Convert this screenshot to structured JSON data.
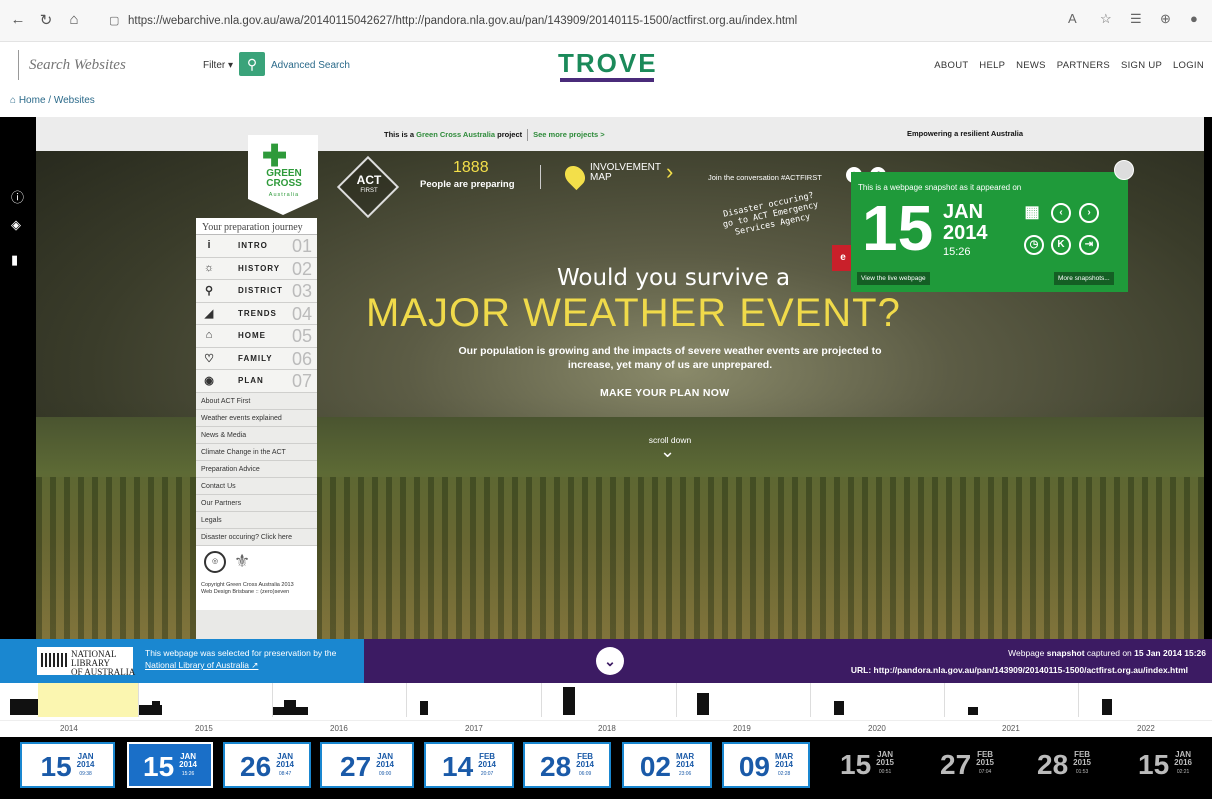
{
  "browser": {
    "url": "https://webarchive.nla.gov.au/awa/20140115042627/http://pandora.nla.gov.au/pan/143909/20140115-1500/actfirst.org.au/index.html"
  },
  "header": {
    "search_placeholder": "Search Websites",
    "filter_label": "Filter ▾",
    "advanced_search": "Advanced Search",
    "logo": "TROVE",
    "nav": [
      "ABOUT",
      "HELP",
      "NEWS",
      "PARTNERS",
      "SIGN UP",
      "LOGIN"
    ]
  },
  "breadcrumb": "Home / Websites",
  "archived_page": {
    "strip_project": "This is a ",
    "strip_gca": "Green Cross Australia",
    "strip_project_end": " project",
    "strip_more": "See more projects >",
    "strip_tagline": "Empowering a resilient Australia",
    "gc_logo": "GREEN\nCROSS",
    "gc_sub": "Australia",
    "act": "ACT",
    "act_sub": "FIRST",
    "people_num": "1888",
    "people_txt": "People are preparing",
    "involvement": "INVOLVEMENT\nMAP",
    "join": "Join the conversation #ACTFIRST",
    "disaster_note": "Disaster occuring?\ngo to ACT Emergency\nServices Agency",
    "red_btn": "e",
    "hero_q": "Would you survive a",
    "hero_big": "MAJOR WEATHER EVENT?",
    "hero_body": "Our population is growing and the impacts of severe weather events are projected to increase, yet many of us are unprepared.",
    "cta": "MAKE YOUR PLAN NOW",
    "scroll": "scroll down",
    "journey_title": "Your preparation journey",
    "menu": [
      {
        "icon": "i",
        "label": "INTRO",
        "num": "01"
      },
      {
        "icon": "☼",
        "label": "HISTORY",
        "num": "02"
      },
      {
        "icon": "⚲",
        "label": "DISTRICT",
        "num": "03"
      },
      {
        "icon": "◢",
        "label": "TRENDS",
        "num": "04"
      },
      {
        "icon": "⌂",
        "label": "HOME",
        "num": "05"
      },
      {
        "icon": "♡",
        "label": "FAMILY",
        "num": "06"
      },
      {
        "icon": "◉",
        "label": "PLAN",
        "num": "07"
      }
    ],
    "links": [
      "About ACT First",
      "Weather events explained",
      "News & Media",
      "Climate Change in the ACT",
      "Preparation Advice",
      "Contact Us",
      "Our Partners",
      "Legals",
      "Disaster occuring? Click here"
    ],
    "copyright": "Copyright Green Cross Australia 2013\nWeb Design Brisbane :: (zero)seven"
  },
  "snapshot_popup": {
    "title": "This is a webpage snapshot as it appeared on",
    "day": "15",
    "month": "JAN",
    "year": "2014",
    "time": "15:26",
    "live_btn": "View the live webpage",
    "more_btn": "More snapshots..."
  },
  "nla_bar": {
    "logo": "NATIONAL\nLIBRARY\nOF AUSTRALIA",
    "text1": "This webpage was selected for preservation by the",
    "text2": "National Library of Australia ↗",
    "captured_pre": "Webpage ",
    "captured_bold": "snapshot",
    "captured_mid": " captured on ",
    "captured_date": "15 Jan 2014 15:26",
    "url": "URL: http://pandora.nla.gov.au/pan/143909/20140115-1500/actfirst.org.au/index.html"
  },
  "timeline": {
    "years": [
      "2014",
      "2015",
      "2016",
      "2017",
      "2018",
      "2019",
      "2020",
      "2021",
      "2022"
    ]
  },
  "snapshots": [
    {
      "day": "15",
      "mon": "JAN",
      "yr": "2014",
      "time": "09:38",
      "style": "w"
    },
    {
      "day": "15",
      "mon": "JAN",
      "yr": "2014",
      "time": "15:26",
      "style": "sel"
    },
    {
      "day": "26",
      "mon": "JAN",
      "yr": "2014",
      "time": "08:47",
      "style": "w"
    },
    {
      "day": "27",
      "mon": "JAN",
      "yr": "2014",
      "time": "09:00",
      "style": "w"
    },
    {
      "day": "14",
      "mon": "FEB",
      "yr": "2014",
      "time": "20:07",
      "style": "w"
    },
    {
      "day": "28",
      "mon": "FEB",
      "yr": "2014",
      "time": "06:09",
      "style": "w"
    },
    {
      "day": "02",
      "mon": "MAR",
      "yr": "2014",
      "time": "23:06",
      "style": "w"
    },
    {
      "day": "09",
      "mon": "MAR",
      "yr": "2014",
      "time": "02:28",
      "style": "w"
    },
    {
      "day": "15",
      "mon": "JAN",
      "yr": "2015",
      "time": "00:51",
      "style": "dk"
    },
    {
      "day": "27",
      "mon": "FEB",
      "yr": "2015",
      "time": "07:04",
      "style": "dk"
    },
    {
      "day": "28",
      "mon": "FEB",
      "yr": "2015",
      "time": "01:53",
      "style": "dk"
    },
    {
      "day": "15",
      "mon": "JAN",
      "yr": "2016",
      "time": "02:21",
      "style": "dk"
    }
  ],
  "colors": {
    "trove_green": "#1b8a5a",
    "popup_green": "#1f9a3a",
    "nla_blue": "#1a87d0",
    "nla_purple": "#3c1b63",
    "hero_yellow": "#f0da4a"
  }
}
